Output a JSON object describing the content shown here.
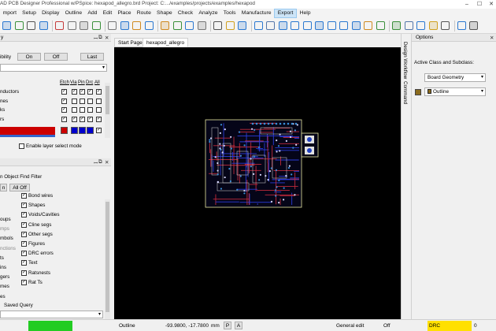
{
  "titlebar": {
    "title": "AD PCB Designer Professional w/PSpice: hexapod_allegro.brd  Project: C:.../examples/projects/examples/hexapod",
    "minimize": "–",
    "maximize": "☐",
    "close": "✕"
  },
  "menu": {
    "items": [
      "mport",
      "Setup",
      "Display",
      "Outline",
      "Add",
      "Edit",
      "Place",
      "Route",
      "Shape",
      "Check",
      "Analyze",
      "Tools",
      "Manufacture",
      "Export",
      "Help"
    ],
    "active_index": 13
  },
  "toolbar": {
    "icon_colors": [
      "#2b78d0",
      "#3a8f3a",
      "#555555",
      "#2b78d0",
      "#c43b3b",
      "#777777",
      "#777777",
      "#3a8f3a",
      "#777777",
      "#2b78d0",
      "#d08a20",
      "#2b78d0",
      "#d08a20",
      "#3a8f3a",
      "#2b78d0",
      "#777777",
      "#555555",
      "#d0a020",
      "#2b78d0",
      "#2b78d0",
      "#5577aa",
      "#2b78d0",
      "#2b78d0",
      "#2b78d0",
      "#2b78d0",
      "#2b78d0",
      "#2b78d0",
      "#2b78d0",
      "#d08a20",
      "#3a8f3a",
      "#3a8f3a",
      "#5577aa",
      "#2b78d0",
      "#d0a020",
      "#555555",
      "#2b78d0",
      "#555555"
    ]
  },
  "visibility": {
    "panel_title": "y",
    "label": "ibility",
    "buttons": [
      "On",
      "Off",
      "Last"
    ],
    "columns": [
      "Etch",
      "Via",
      "Pin",
      "Drc",
      "All"
    ],
    "rows": [
      {
        "label": "nductors",
        "checks": [
          "✓",
          "✓",
          "✓",
          "✓",
          "✓"
        ]
      },
      {
        "label": "nes",
        "checks": [
          "✓",
          "",
          "",
          "",
          ""
        ]
      },
      {
        "label": "ks",
        "checks": [
          "✓",
          "",
          "",
          "",
          ""
        ]
      },
      {
        "label": "rs",
        "checks": [
          "✓",
          "✓",
          "✓",
          "✓",
          "✓"
        ]
      }
    ],
    "color_swatches": [
      "#cc0000",
      "#0000cc",
      "#0000cc",
      "#0000cc"
    ],
    "enable_layer_mode": "Enable layer select mode"
  },
  "find": {
    "panel_title": "n Object Find Filter",
    "buttons": [
      "n",
      "All Off"
    ],
    "left_items": [
      {
        "label": "oups",
        "dim": false
      },
      {
        "label": "mps",
        "dim": true
      },
      {
        "label": "mbols",
        "dim": false
      },
      {
        "label": "nctions",
        "dim": true
      },
      {
        "label": "ts",
        "dim": false
      },
      {
        "label": "ins",
        "dim": false
      },
      {
        "label": "gers",
        "dim": false
      },
      {
        "label": "mes",
        "dim": false
      },
      {
        "label": "es",
        "dim": false
      }
    ],
    "right_items": [
      "Bond wires",
      "Shapes",
      "Voids/Cavities",
      "Cline segs",
      "Other segs",
      "Figures",
      "DRC errors",
      "Text",
      "Ratsnests",
      "Rat Ts"
    ],
    "saved_query": "Saved Query"
  },
  "tabs": [
    "Start Page",
    "hexapod_allegro"
  ],
  "side_strip": [
    "Design Workflow",
    "Command"
  ],
  "options": {
    "panel_title": "Options",
    "active_class_label": "Active Class and Subclass:",
    "class_value": "Board Geometry",
    "subclass_value": "Outline",
    "subclass_color": "#8b6b1e"
  },
  "status": {
    "command": "Outline",
    "coordinates": "-93.9800, -17.7800",
    "units": "mm",
    "btn_p": "P",
    "btn_a": "A",
    "mode": "General edit",
    "state": "Off",
    "drc_label": "DRC",
    "drc_count": "0",
    "indicator_color": "#22cc22",
    "drc_color": "#ffe000"
  }
}
